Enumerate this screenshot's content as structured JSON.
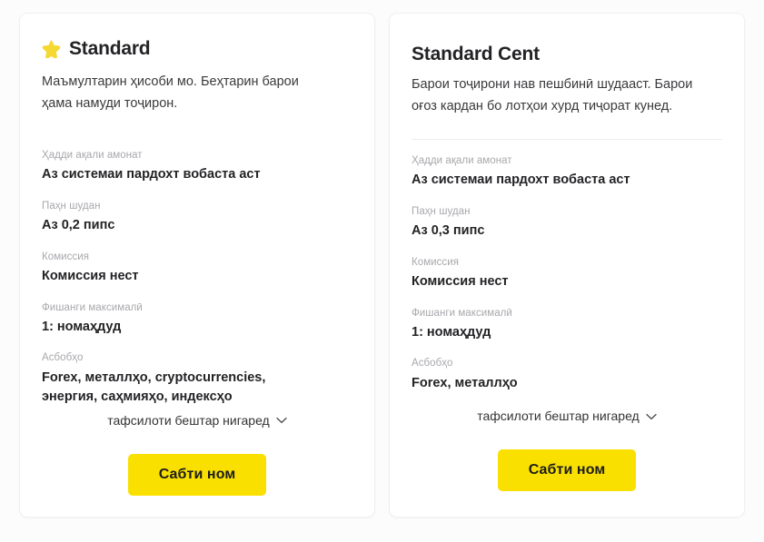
{
  "page": {
    "background_color": "#fcfcfc",
    "card_background_color": "#ffffff",
    "accent_color": "#f9e000",
    "star_color": "#f5d831",
    "label_color": "#a8a8ad",
    "value_color": "#232326"
  },
  "cards": [
    {
      "id": "standard",
      "badge_icon": "star-icon",
      "title": "Standard",
      "description": "Маъмултарин ҳисоби мо. Беҳтарин барои ҳама намуди тоҷирон.",
      "specs": [
        {
          "label": "Ҳадди ақали амонат",
          "value": "Аз системаи пардохт вобаста аст"
        },
        {
          "label": "Паҳн шудан",
          "value": "Аз 0,2 пипс"
        },
        {
          "label": "Комиссия",
          "value": "Комиссия нест"
        },
        {
          "label": "Фишанги максималӣ",
          "value": "1: номаҳдуд"
        },
        {
          "label": "Асбобҳо",
          "value": "Forex, металлҳо, cryptocurrencies, энергия, саҳмияҳо, индексҳо"
        }
      ],
      "more_link": "тафсилоти бештар нигаред",
      "more_link_icon": "chevron-down-icon",
      "cta_label": "Сабти ном"
    },
    {
      "id": "standard-cent",
      "badge_icon": null,
      "title": "Standard Cent",
      "description": "Барои тоҷирони нав пешбинӣ шудааст. Барои оғоз кардан бо лотҳои хурд тиҷорат кунед.",
      "specs": [
        {
          "label": "Ҳадди ақали амонат",
          "value": "Аз системаи пардохт вобаста аст"
        },
        {
          "label": "Паҳн шудан",
          "value": "Аз 0,3 пипс"
        },
        {
          "label": "Комиссия",
          "value": "Комиссия нест"
        },
        {
          "label": "Фишанги максималӣ",
          "value": "1: номаҳдуд"
        },
        {
          "label": "Асбобҳо",
          "value": "Forex, металлҳо"
        }
      ],
      "more_link": "тафсилоти бештар нигаред",
      "more_link_icon": "chevron-down-icon",
      "cta_label": "Сабти ном"
    }
  ]
}
